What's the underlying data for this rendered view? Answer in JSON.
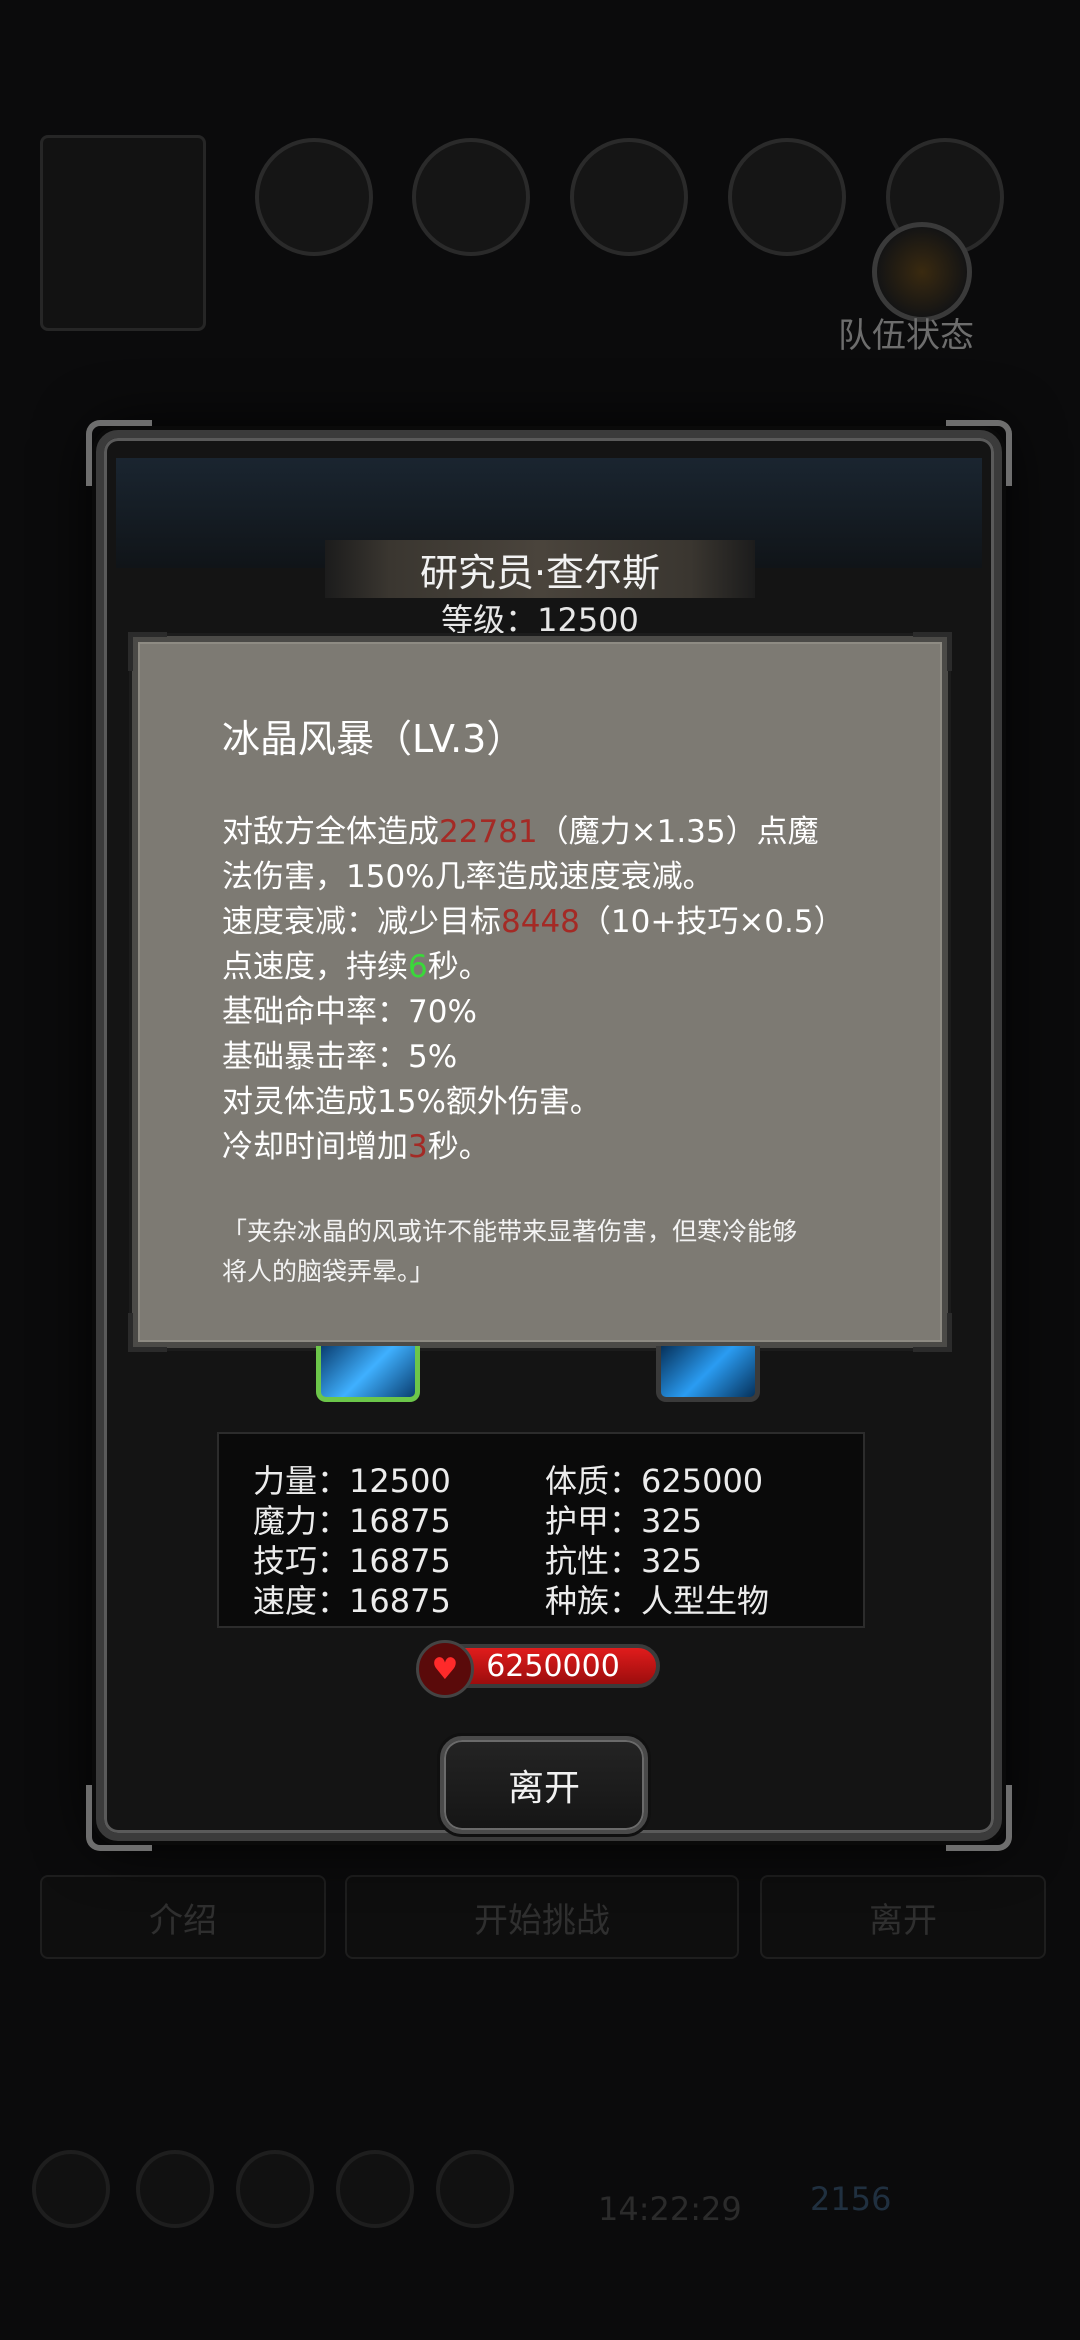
{
  "background": {
    "team_status_label": "队伍状态",
    "bottom_buttons": [
      "介绍",
      "开始挑战",
      "离开"
    ],
    "time": "14:22:29",
    "count": "2156"
  },
  "monster": {
    "name": "研究员·查尔斯",
    "level_line": "等级：12500"
  },
  "skill": {
    "title": "冰晶风暴（LV.3）",
    "lines": [
      {
        "a": "对敌方全体造成",
        "n": "22781",
        "b": "（魔力×1.35）点魔"
      },
      {
        "a": "法伤害，150%几率造成速度衰减。"
      },
      {
        "a": "速度衰减：减少目标",
        "n": "8448",
        "b": "（10+技巧×0.5）"
      },
      {
        "a": "点速度，持续",
        "g": "6",
        "b": "秒。"
      },
      {
        "a": "基础命中率：70%"
      },
      {
        "a": "基础暴击率：5%"
      },
      {
        "a": "对灵体造成15%额外伤害。"
      },
      {
        "a": "冷却时间增加",
        "n": "3",
        "b": "秒。"
      }
    ],
    "flavor_lines": [
      "「夹杂冰晶的风或许不能带来显著伤害，但寒冷能够",
      "将人的脑袋弄晕。」"
    ]
  },
  "stats": {
    "strength": "力量：12500",
    "magic": "魔力：16875",
    "skill": "技巧：16875",
    "speed": "速度：16875",
    "constitution": "体质：625000",
    "armor": "护甲：325",
    "resistance": "抗性：325",
    "race": "种族：人型生物"
  },
  "hp": "6250000",
  "leave_label": "离开",
  "colors": {
    "damage_number": "#a42a25",
    "duration_number": "#3ad83a",
    "hp_bar": "#d01818",
    "desc_panel": "#7d7a73"
  }
}
